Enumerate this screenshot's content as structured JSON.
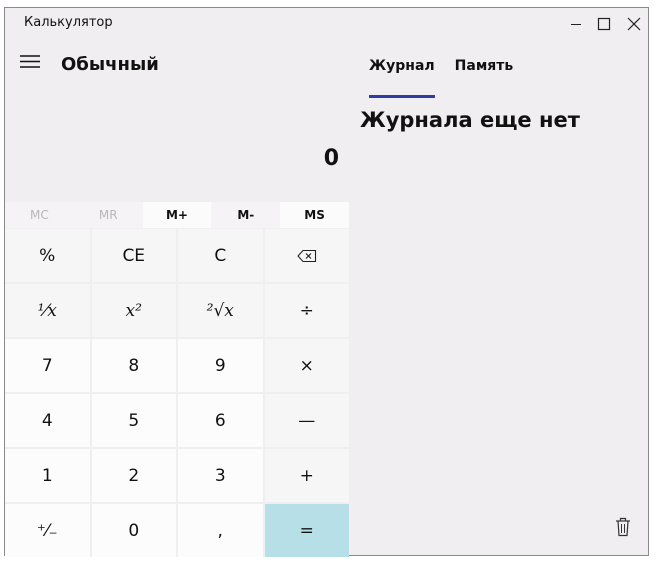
{
  "window": {
    "title": "Калькулятор"
  },
  "header": {
    "mode": "Обычный"
  },
  "display": {
    "value": "0"
  },
  "memory": {
    "buttons": [
      {
        "label": "MC",
        "state": "disabled"
      },
      {
        "label": "MR",
        "state": "disabled"
      },
      {
        "label": "M+",
        "state": "enabled"
      },
      {
        "label": "M-",
        "state": "enabled"
      },
      {
        "label": "MS",
        "state": "active"
      }
    ]
  },
  "keys": {
    "percent": "%",
    "ce": "CE",
    "c": "C",
    "inverse": "¹⁄x",
    "square": "x²",
    "sqrt": "²√x",
    "divide": "÷",
    "seven": "7",
    "eight": "8",
    "nine": "9",
    "multiply": "×",
    "four": "4",
    "five": "5",
    "six": "6",
    "minus": "—",
    "one": "1",
    "two": "2",
    "three": "3",
    "plus": "+",
    "negate": "⁺⁄₋",
    "zero": "0",
    "comma": ",",
    "equals": "="
  },
  "panel": {
    "tabs": [
      "Журнал",
      "Память"
    ],
    "empty_message": "Журнала еще нет"
  },
  "colors": {
    "accent": "#2e3ca3",
    "equals_bg": "#b6dfe8"
  },
  "icons": [
    "minimize-icon",
    "maximize-icon",
    "close-icon",
    "hamburger-icon",
    "backspace-icon",
    "trash-icon"
  ]
}
